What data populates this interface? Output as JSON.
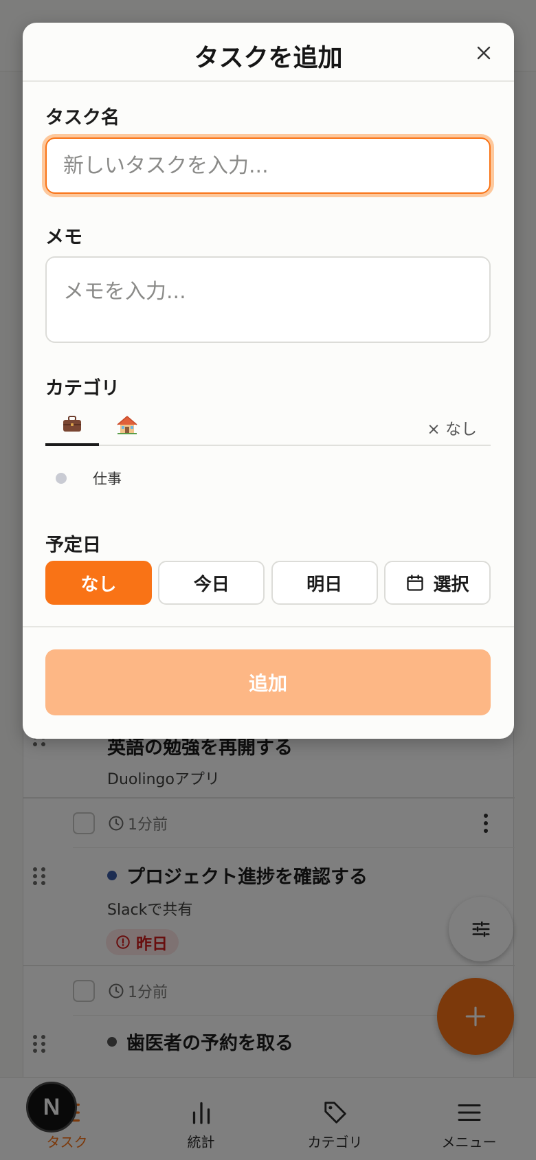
{
  "modal": {
    "title": "タスクを追加",
    "task_name_label": "タスク名",
    "task_name_placeholder": "新しいタスクを入力...",
    "memo_label": "メモ",
    "memo_placeholder": "メモを入力...",
    "category_label": "カテゴリ",
    "category_tabs": [
      {
        "icon": "briefcase-icon",
        "glyph": "💼",
        "selected": true
      },
      {
        "icon": "house-icon",
        "glyph": "🏠",
        "selected": false
      }
    ],
    "category_none": "× なし",
    "category_option": "仕事",
    "due_label": "予定日",
    "due_options": [
      "なし",
      "今日",
      "明日",
      "選択"
    ],
    "due_selected": "なし",
    "submit_label": "追加"
  },
  "tasks": [
    {
      "title": "英語の勉強を再開する",
      "memo": "Duolingoアプリ"
    },
    {
      "time": "1分前",
      "title": "プロジェクト進捗を確認する",
      "memo": "Slackで共有",
      "category_color": "#3b5ba5",
      "due": "昨日"
    },
    {
      "time": "1分前",
      "title": "歯医者の予約を取る",
      "category_color": "#555555"
    }
  ],
  "nav": {
    "items": [
      {
        "label": "タスク",
        "icon": "checklist-icon",
        "active": true
      },
      {
        "label": "統計",
        "icon": "bar-chart-icon",
        "active": false
      },
      {
        "label": "カテゴリ",
        "icon": "tag-icon",
        "active": false
      },
      {
        "label": "メニュー",
        "icon": "menu-icon",
        "active": false
      }
    ]
  },
  "badge": {
    "letter": "N"
  },
  "colors": {
    "accent": "#f97316",
    "accent_light": "#fdb785",
    "danger": "#d11c1c"
  }
}
